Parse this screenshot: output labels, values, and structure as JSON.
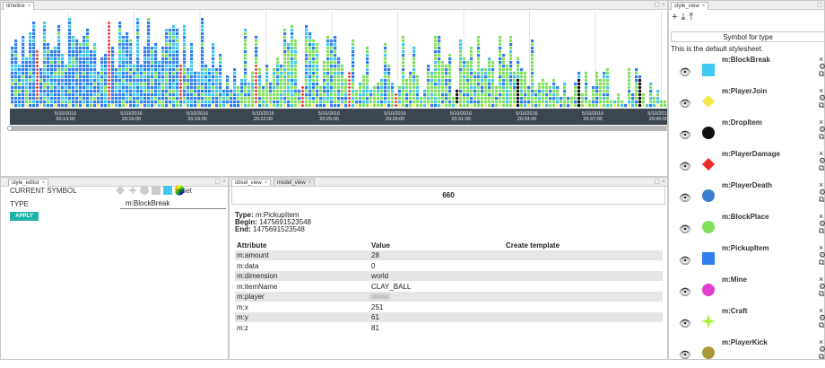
{
  "timeline": {
    "tab_label": "timeline",
    "ticks": [
      {
        "date": "5/10/2016",
        "time": "20:13:00"
      },
      {
        "date": "5/10/2016",
        "time": "20:16:00"
      },
      {
        "date": "5/10/2016",
        "time": "20:19:00"
      },
      {
        "date": "5/10/2016",
        "time": "20:22:00"
      },
      {
        "date": "5/10/2016",
        "time": "20:25:00"
      },
      {
        "date": "5/10/2016",
        "time": "20:28:00"
      },
      {
        "date": "5/10/2016",
        "time": "20:31:00"
      },
      {
        "date": "5/10/2016",
        "time": "20:34:00"
      },
      {
        "date": "5/10/2016",
        "time": "20:37:00"
      },
      {
        "date": "5/10/2016",
        "time": "20:40:00"
      }
    ]
  },
  "style_editor": {
    "tab_label": "style_editor",
    "current_symbol_label": "CURRENT SYMBOL",
    "reset_label": "reset",
    "type_label": "TYPE",
    "type_value": "m:BlockBreak",
    "apply_label": "APPLY"
  },
  "obsel_view": {
    "tab_label": "obsel_view",
    "tab2_label": "model_view",
    "id": "660",
    "type_label": "Type:",
    "type_value": "m:PickupItem",
    "begin_label": "Begin:",
    "begin_value": "1475691523548",
    "end_label": "End:",
    "end_value": "1475691523548",
    "headers": [
      "Attribute",
      "Value",
      "Create template"
    ],
    "rows": [
      {
        "attr": "m:amount",
        "value": "28"
      },
      {
        "attr": "m:data",
        "value": "0"
      },
      {
        "attr": "m:dimension",
        "value": "world"
      },
      {
        "attr": "m:itemName",
        "value": "CLAY_BALL"
      },
      {
        "attr": "m:player",
        "value": ""
      },
      {
        "attr": "m:x",
        "value": "251"
      },
      {
        "attr": "m:y",
        "value": "61"
      },
      {
        "attr": "m:z",
        "value": "81"
      }
    ]
  },
  "style_view": {
    "tab_label": "style_view",
    "symbol_header": "Symbol for type",
    "description": "This is the default stylesheet.",
    "items": [
      {
        "label": "m:BlockBreak",
        "shape": "square",
        "color": "#40c8f0"
      },
      {
        "label": "m:PlayerJoin",
        "shape": "diamond",
        "color": "#f4e84a"
      },
      {
        "label": "m:DropItem",
        "shape": "circle",
        "color": "#111111"
      },
      {
        "label": "m:PlayerDamage",
        "shape": "diamond",
        "color": "#ee2b2b"
      },
      {
        "label": "m:PlayerDeath",
        "shape": "circle",
        "color": "#3a7fcf"
      },
      {
        "label": "m:BlockPlace",
        "shape": "circle",
        "color": "#7ee05a"
      },
      {
        "label": "m:PickupItem",
        "shape": "square",
        "color": "#2f7ef0"
      },
      {
        "label": "m:Mine",
        "shape": "circle",
        "color": "#e33fcf"
      },
      {
        "label": "m:Craft",
        "shape": "star",
        "color": "#a8f030"
      },
      {
        "label": "m:PlayerKick",
        "shape": "circle",
        "color": "#a89a3a"
      }
    ]
  }
}
